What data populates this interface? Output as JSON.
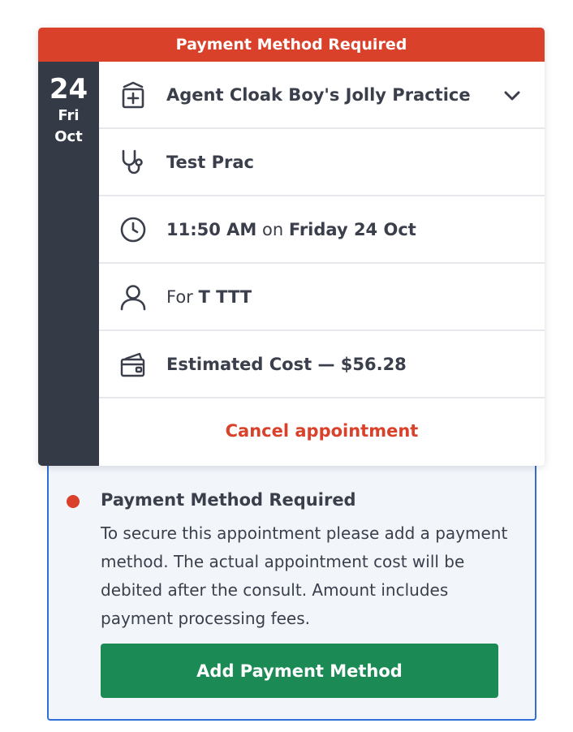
{
  "banner": {
    "text": "Payment Method Required"
  },
  "date": {
    "day": "24",
    "weekday": "Fri",
    "month": "Oct"
  },
  "practice": {
    "name": "Agent Cloak Boy's Jolly Practice"
  },
  "practitioner": {
    "name": "Test Prac"
  },
  "time": {
    "time": "11:50 AM",
    "connector": " on ",
    "date": "Friday 24 Oct"
  },
  "patient": {
    "prefix": "For ",
    "name": "T TTT"
  },
  "cost": {
    "text": "Estimated Cost — $56.28"
  },
  "cancel": {
    "label": "Cancel appointment"
  },
  "notice": {
    "title": "Payment Method Required",
    "body": "To secure this appointment please add a payment method. The actual appointment cost will be debited after the consult. Amount includes payment processing fees.",
    "button": "Add Payment Method"
  },
  "colors": {
    "alert": "#d9412b",
    "primary": "#1b8a55",
    "strip": "#353a47",
    "focus_border": "#2f6fd6"
  },
  "icons": [
    "clinic-icon",
    "stethoscope-icon",
    "clock-icon",
    "person-icon",
    "wallet-card-icon",
    "chevron-down-icon"
  ]
}
